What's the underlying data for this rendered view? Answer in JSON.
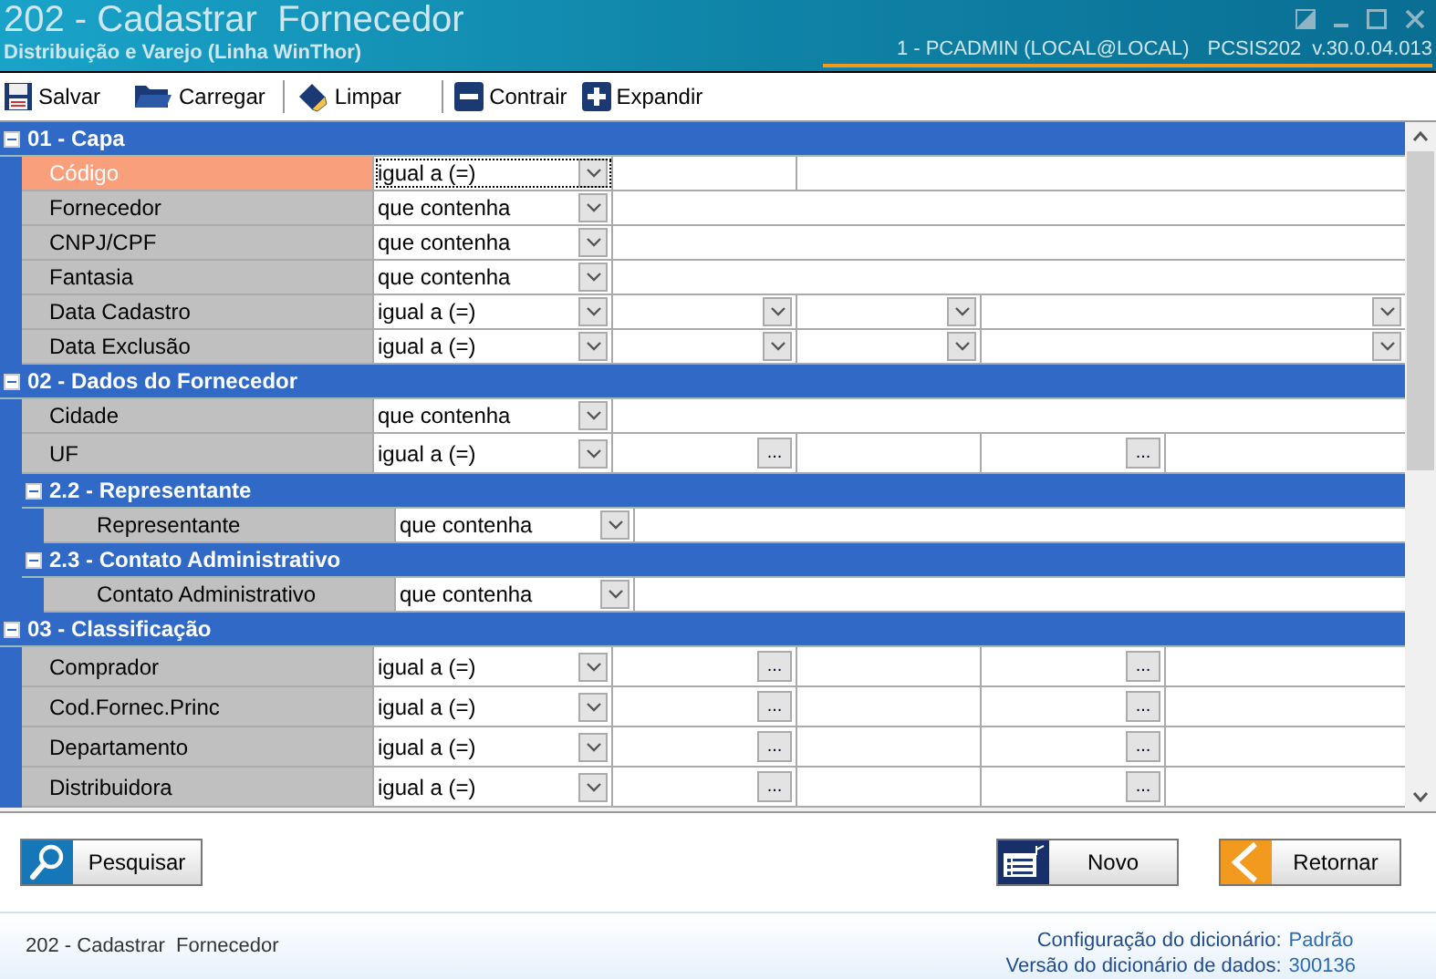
{
  "window": {
    "title": "202 - Cadastrar  Fornecedor",
    "subtitle": "Distribuição e Varejo (Linha WinThor)",
    "session": "1 - PCADMIN (LOCAL@LOCAL)",
    "program": "PCSIS202",
    "version": "v.30.0.04.013"
  },
  "toolbar": [
    {
      "kind": "save",
      "label": "Salvar"
    },
    {
      "kind": "load",
      "label": "Carregar"
    },
    {
      "kind": "clear",
      "label": "Limpar"
    },
    {
      "kind": "collapse",
      "label": "Contrair"
    },
    {
      "kind": "expand",
      "label": "Expandir"
    }
  ],
  "grid": [
    {
      "kind": "group",
      "title": "01 - Capa",
      "expanded": true,
      "children": [
        {
          "kind": "code",
          "label": "Código",
          "operator": "igual a (=)",
          "selected": true
        },
        {
          "kind": "text",
          "label": "Fornecedor",
          "operator": "que contenha",
          "selected": false
        },
        {
          "kind": "text",
          "label": "CNPJ/CPF",
          "operator": "que contenha",
          "selected": false
        },
        {
          "kind": "text",
          "label": "Fantasia",
          "operator": "que contenha",
          "selected": false
        },
        {
          "kind": "date",
          "label": "Data Cadastro",
          "operator": "igual a (=)",
          "selected": false
        },
        {
          "kind": "date",
          "label": "Data Exclusão",
          "operator": "igual a (=)",
          "selected": false
        }
      ]
    },
    {
      "kind": "group",
      "title": "02 - Dados do Fornecedor",
      "expanded": true,
      "children": [
        {
          "kind": "text",
          "label": "Cidade",
          "operator": "que contenha",
          "selected": false
        },
        {
          "kind": "lookup",
          "label": "UF",
          "operator": "igual a (=)",
          "selected": false,
          "button": "..."
        },
        {
          "kind": "group",
          "title": "2.2 - Representante",
          "expanded": true,
          "children": [
            {
              "kind": "text",
              "label": "Representante",
              "operator": "que contenha",
              "selected": false
            }
          ]
        },
        {
          "kind": "group",
          "title": "2.3 - Contato Administrativo",
          "expanded": true,
          "children": [
            {
              "kind": "text",
              "label": "Contato Administrativo",
              "operator": "que contenha",
              "selected": false
            }
          ]
        }
      ]
    },
    {
      "kind": "group",
      "title": "03 - Classificação",
      "expanded": true,
      "children": [
        {
          "kind": "lookup",
          "label": "Comprador",
          "operator": "igual a (=)",
          "selected": false,
          "button": "..."
        },
        {
          "kind": "lookup",
          "label": "Cod.Fornec.Princ",
          "operator": "igual a (=)",
          "selected": false,
          "button": "..."
        },
        {
          "kind": "lookup",
          "label": "Departamento",
          "operator": "igual a (=)",
          "selected": false,
          "button": "..."
        },
        {
          "kind": "lookup",
          "label": "Distribuidora",
          "operator": "igual a (=)",
          "selected": false,
          "button": "..."
        }
      ]
    }
  ],
  "actions": [
    {
      "kind": "search",
      "label": "Pesquisar"
    },
    {
      "kind": "new",
      "label": "Novo"
    },
    {
      "kind": "back",
      "label": "Retornar"
    }
  ],
  "footer": {
    "screen": "202 - Cadastrar  Fornecedor",
    "dictionary_config_label": "Configuração do dicionário:",
    "dictionary_config": "Padrão",
    "dictionary_version_label": "Versão do dicionário de dados:",
    "dictionary_version": "300136"
  }
}
